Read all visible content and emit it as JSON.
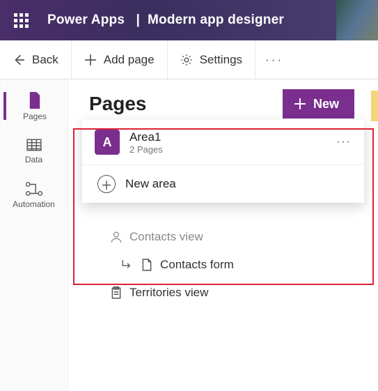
{
  "header": {
    "app_name": "Power Apps",
    "separator": "|",
    "context": "Modern app designer"
  },
  "cmdbar": {
    "back": "Back",
    "add_page": "Add page",
    "settings": "Settings"
  },
  "leftnav": {
    "pages": "Pages",
    "data": "Data",
    "automation": "Automation"
  },
  "main": {
    "title": "Pages",
    "new_btn": "New",
    "area_selector": "Area1",
    "popup": {
      "area_label": "Area1",
      "area_letter": "A",
      "area_sub": "2 Pages",
      "new_area": "New area"
    },
    "tree": {
      "contacts_view": "Contacts view",
      "contacts_form": "Contacts form",
      "territories_view": "Territories view"
    }
  }
}
